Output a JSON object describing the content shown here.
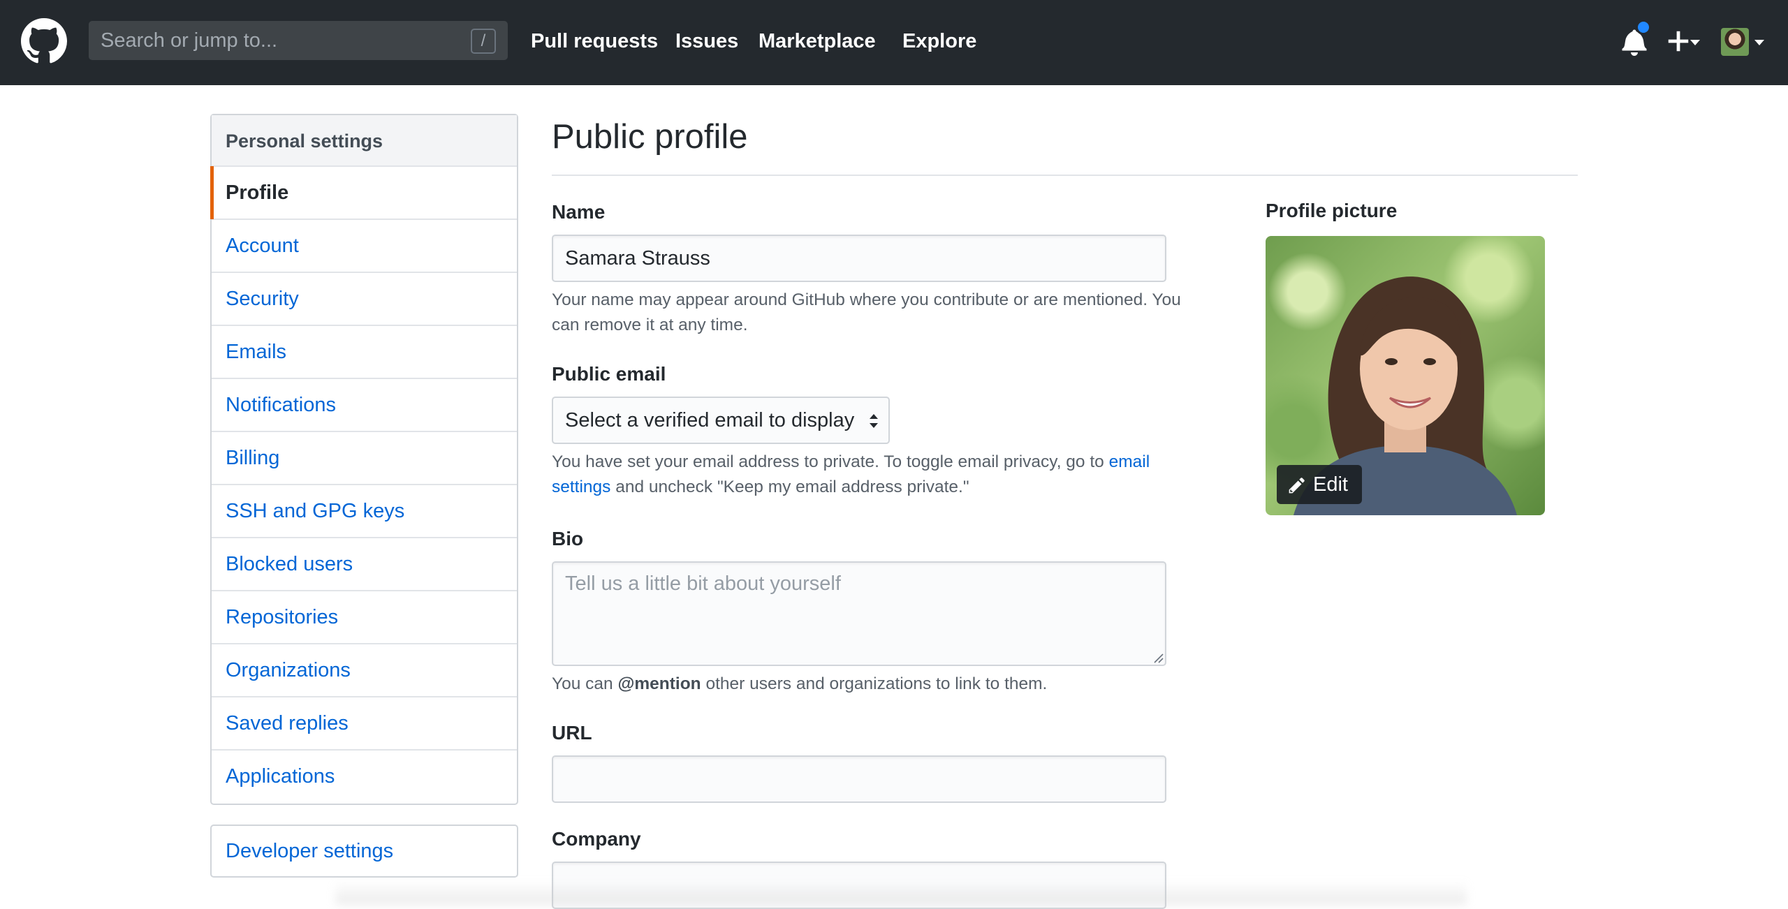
{
  "header": {
    "search_placeholder": "Search or jump to...",
    "search_shortcut": "/",
    "nav": [
      "Pull requests",
      "Issues",
      "Marketplace",
      "Explore"
    ],
    "icons": {
      "logo": "github-octocat-icon",
      "notifications": "bell-icon",
      "create": "plus-icon",
      "avatar": "user-avatar"
    },
    "notification_dot_color": "#2188ff"
  },
  "sidebar": {
    "heading": "Personal settings",
    "items": [
      {
        "label": "Profile",
        "selected": true
      },
      {
        "label": "Account"
      },
      {
        "label": "Security"
      },
      {
        "label": "Emails"
      },
      {
        "label": "Notifications"
      },
      {
        "label": "Billing"
      },
      {
        "label": "SSH and GPG keys"
      },
      {
        "label": "Blocked users"
      },
      {
        "label": "Repositories"
      },
      {
        "label": "Organizations"
      },
      {
        "label": "Saved replies"
      },
      {
        "label": "Applications"
      }
    ],
    "developer_settings": "Developer settings",
    "selected_accent": "#e36209",
    "link_color": "#0366d6"
  },
  "main": {
    "title": "Public profile",
    "name": {
      "label": "Name",
      "value": "Samara Strauss",
      "note": "Your name may appear around GitHub where you contribute or are mentioned. You can remove it at any time."
    },
    "public_email": {
      "label": "Public email",
      "selected": "Select a verified email to display",
      "note_before": "You have set your email address to private. To toggle email privacy, go to ",
      "note_link": "email settings",
      "note_after": " and uncheck \"Keep my email address private.\""
    },
    "bio": {
      "label": "Bio",
      "placeholder": "Tell us a little bit about yourself",
      "note_before": "You can ",
      "note_mention": "@mention",
      "note_after": " other users and organizations to link to them."
    },
    "url": {
      "label": "URL",
      "value": ""
    },
    "company": {
      "label": "Company",
      "value": ""
    }
  },
  "profile_picture": {
    "label": "Profile picture",
    "edit_label": "Edit",
    "edit_icon": "pencil-icon"
  }
}
